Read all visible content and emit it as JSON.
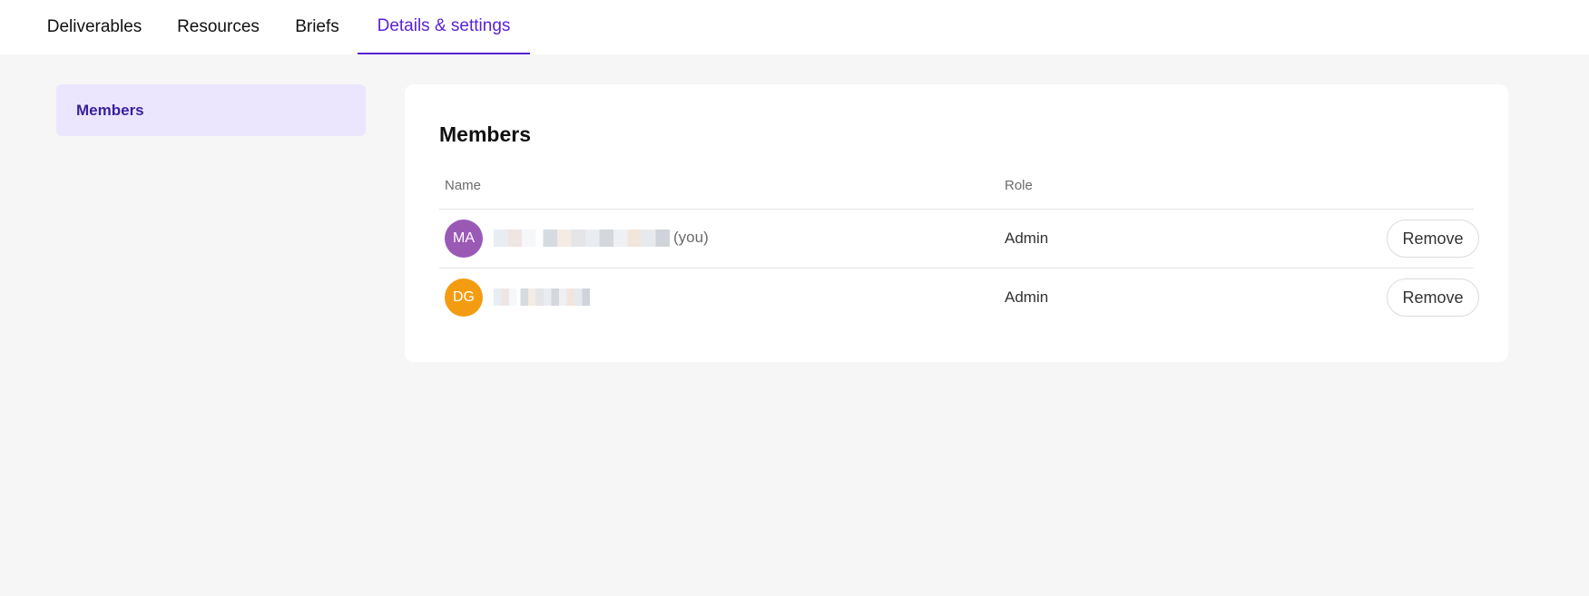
{
  "tabs": [
    {
      "label": "Deliverables",
      "active": false
    },
    {
      "label": "Resources",
      "active": false
    },
    {
      "label": "Briefs",
      "active": false
    },
    {
      "label": "Details & settings",
      "active": true
    }
  ],
  "sidebar": {
    "items": [
      {
        "label": "Members",
        "selected": true
      }
    ]
  },
  "members_card": {
    "title": "Members",
    "columns": {
      "name": "Name",
      "role": "Role"
    },
    "rows": [
      {
        "initials": "MA",
        "avatar_color": "#9b59b6",
        "name_redacted": true,
        "suffix": "(you)",
        "role": "Admin",
        "action": "Remove"
      },
      {
        "initials": "DG",
        "avatar_color": "#f39c12",
        "name_redacted": true,
        "suffix": "",
        "role": "Admin",
        "action": "Remove"
      }
    ]
  },
  "colors": {
    "accent": "#5a22d6",
    "sidebar_selected_bg": "#ebe6fd",
    "page_bg": "#f6f6f6"
  }
}
